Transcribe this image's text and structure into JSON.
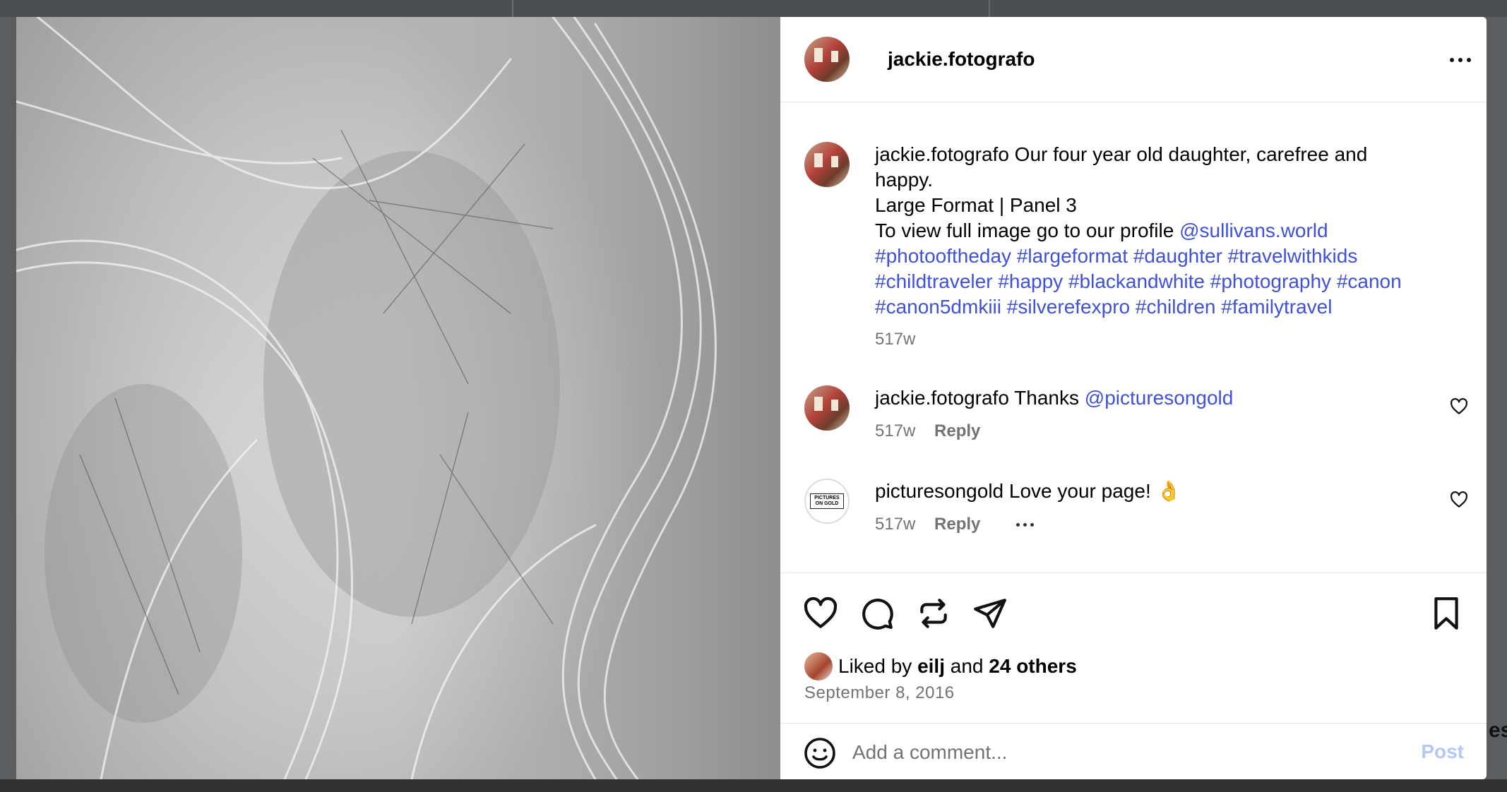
{
  "post": {
    "username": "jackie.fotografo",
    "caption": {
      "username": "jackie.fotografo",
      "line1": "Our four year old daughter, carefree and",
      "line2": "happy.",
      "line3": "Large Format | Panel 3",
      "line4_text": "To view full image go to our profile",
      "line4_mention": "@sullivans.world",
      "hashtags_line1": [
        "#photooftheday",
        "#largeformat",
        "#daughter",
        "#travelwithkids"
      ],
      "hashtags_line2": [
        "#childtraveler",
        "#happy",
        "#blackandwhite",
        "#photography",
        "#canon"
      ],
      "hashtags_line3": [
        "#canon5dmkiii",
        "#silverefexpro",
        "#children",
        "#familytravel"
      ],
      "age": "517w"
    },
    "comments": [
      {
        "username": "jackie.fotografo",
        "text": "Thanks",
        "mention": "@picturesongold",
        "age": "517w",
        "reply_label": "Reply"
      },
      {
        "username": "picturesongold",
        "text": "Love your page! 👌",
        "age": "517w",
        "reply_label": "Reply",
        "avatar_logo": "PICTURES ON GOLD"
      }
    ],
    "likes": {
      "prefix": "Liked by",
      "user": "eilj",
      "joiner": "and",
      "others": "24 others"
    },
    "date": "September 8, 2016",
    "add_comment": {
      "placeholder": "Add a comment...",
      "post_label": "Post"
    },
    "icons": {
      "more": "more-horizontal-icon",
      "like": "heart-icon",
      "comment": "comment-bubble-icon",
      "repost": "repost-icon",
      "share": "send-icon",
      "save": "bookmark-icon",
      "emoji": "emoji-smiley-icon"
    },
    "colors": {
      "link": "#3f51d8",
      "muted": "#737373",
      "post_disabled": "#b3c8f5"
    }
  },
  "background": {
    "edge_text": "es"
  }
}
